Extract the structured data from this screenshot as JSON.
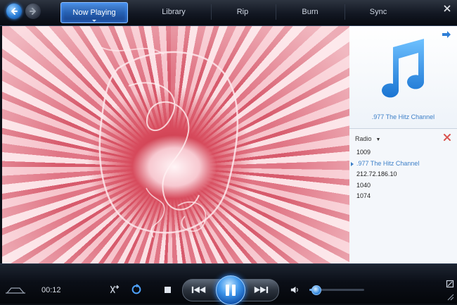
{
  "tabs": [
    {
      "label": "Now Playing",
      "active": true
    },
    {
      "label": "Library",
      "active": false
    },
    {
      "label": "Rip",
      "active": false
    },
    {
      "label": "Burn",
      "active": false
    },
    {
      "label": "Sync",
      "active": false
    }
  ],
  "icons": {
    "back": "back-arrow-icon",
    "forward": "forward-arrow-icon",
    "close": "close-icon",
    "music": "music-note-icon",
    "panel_arrow": "arrow-right-icon",
    "remove": "remove-x-icon",
    "shuffle": "shuffle-icon",
    "repeat": "repeat-icon",
    "stop": "stop-icon",
    "previous": "previous-icon",
    "pause": "pause-icon",
    "next": "next-icon",
    "volume": "volume-icon"
  },
  "now_playing": {
    "station": ".977 The Hitz Channel"
  },
  "playlist": {
    "title": "Radio",
    "items": [
      {
        "label": "1009",
        "current": false
      },
      {
        "label": ".977 The Hitz Channel",
        "current": true
      },
      {
        "label": "212.72.186.10",
        "current": false
      },
      {
        "label": "1040",
        "current": false
      },
      {
        "label": "1074",
        "current": false
      }
    ]
  },
  "controls": {
    "elapsed_time": "00:12",
    "volume_level": 0.12
  },
  "colors": {
    "accent": "#3c7fc8",
    "active_tab": "#2761b3",
    "remove_x": "#d9534f"
  }
}
